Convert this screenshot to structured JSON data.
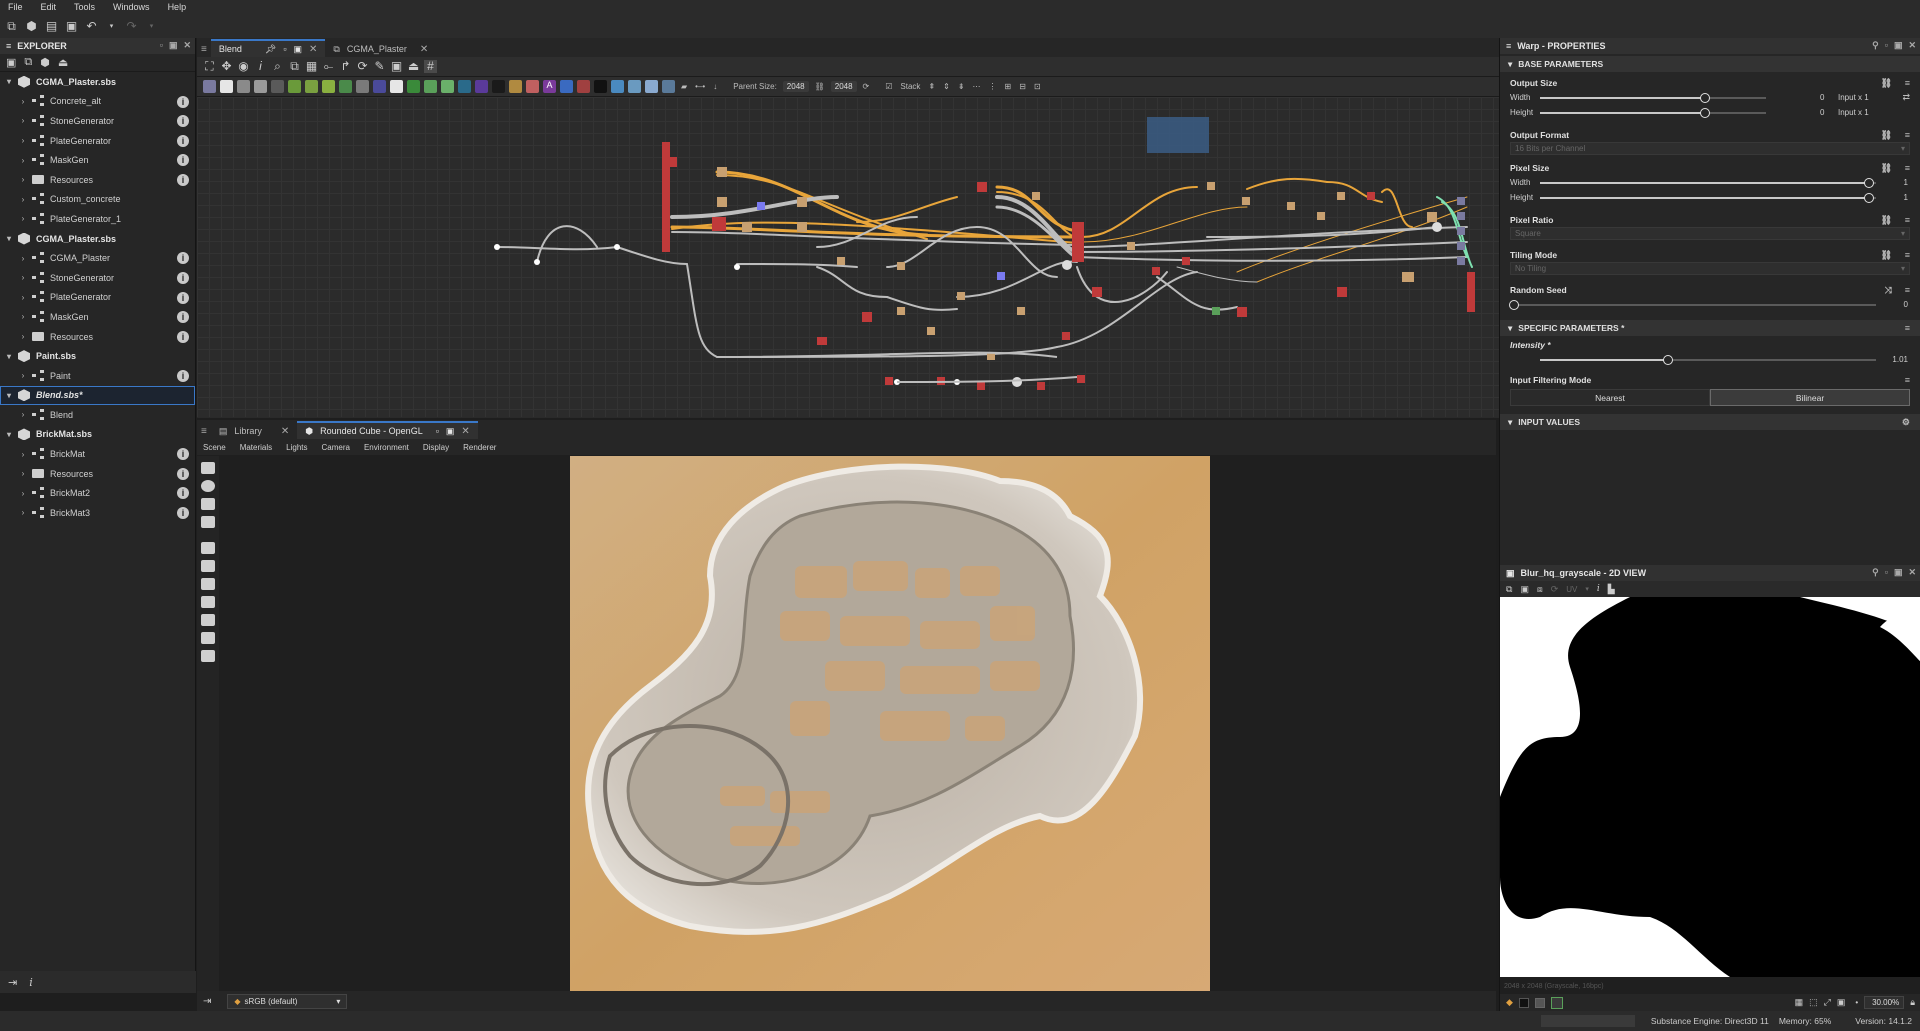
{
  "menu": [
    "File",
    "Edit",
    "Tools",
    "Windows",
    "Help"
  ],
  "explorer": {
    "title": "EXPLORER",
    "tree": [
      {
        "label": "CGMA_Plaster.sbs",
        "kind": "package",
        "depth": 0
      },
      {
        "label": "Concrete_alt",
        "kind": "graph",
        "depth": 1,
        "info": true
      },
      {
        "label": "StoneGenerator",
        "kind": "graph",
        "depth": 1,
        "info": true
      },
      {
        "label": "PlateGenerator",
        "kind": "graph",
        "depth": 1,
        "info": true
      },
      {
        "label": "MaskGen",
        "kind": "graph",
        "depth": 1,
        "info": true
      },
      {
        "label": "Resources",
        "kind": "folder",
        "depth": 1,
        "info": true
      },
      {
        "label": "Custom_concrete",
        "kind": "graph",
        "depth": 1,
        "info": false
      },
      {
        "label": "PlateGenerator_1",
        "kind": "graph",
        "depth": 1,
        "info": false
      },
      {
        "label": "CGMA_Plaster.sbs",
        "kind": "package",
        "depth": 0
      },
      {
        "label": "CGMA_Plaster",
        "kind": "graph",
        "depth": 1,
        "info": true
      },
      {
        "label": "StoneGenerator",
        "kind": "graph",
        "depth": 1,
        "info": true
      },
      {
        "label": "PlateGenerator",
        "kind": "graph",
        "depth": 1,
        "info": true
      },
      {
        "label": "MaskGen",
        "kind": "graph",
        "depth": 1,
        "info": true
      },
      {
        "label": "Resources",
        "kind": "folder",
        "depth": 1,
        "info": true
      },
      {
        "label": "Paint.sbs",
        "kind": "package",
        "depth": 0
      },
      {
        "label": "Paint",
        "kind": "graph",
        "depth": 1,
        "info": true
      },
      {
        "label": "Blend.sbs*",
        "kind": "package",
        "depth": 0,
        "selected": true,
        "italic": true
      },
      {
        "label": "Blend",
        "kind": "graph",
        "depth": 1,
        "info": false
      },
      {
        "label": "BrickMat.sbs",
        "kind": "package",
        "depth": 0
      },
      {
        "label": "BrickMat",
        "kind": "graph",
        "depth": 1,
        "info": true
      },
      {
        "label": "Resources",
        "kind": "folder",
        "depth": 1,
        "info": true
      },
      {
        "label": "BrickMat2",
        "kind": "graph",
        "depth": 1,
        "info": true
      },
      {
        "label": "BrickMat3",
        "kind": "graph",
        "depth": 1,
        "info": true
      }
    ]
  },
  "graph": {
    "tabs": [
      {
        "label": "Blend",
        "active": true
      },
      {
        "label": "CGMA_Plaster",
        "active": false
      }
    ],
    "parent_size_label": "Parent Size:",
    "parent_size": "2048",
    "size2": "2048",
    "stack_label": "Stack"
  },
  "view3d": {
    "tabs": [
      {
        "label": "Library",
        "active": false
      },
      {
        "label": "Rounded Cube - OpenGL",
        "active": true
      }
    ],
    "menu": [
      "Scene",
      "Materials",
      "Lights",
      "Camera",
      "Environment",
      "Display",
      "Renderer"
    ],
    "colorspace": "sRGB (default)"
  },
  "props": {
    "title": "Warp - PROPERTIES",
    "base_section": "BASE PARAMETERS",
    "output_size": {
      "label": "Output Size",
      "width_label": "Width",
      "height_label": "Height",
      "width_val": "0",
      "height_val": "0",
      "width_mode": "Input x 1",
      "height_mode": "Input x 1",
      "width_level": 0.73,
      "height_level": 0.73
    },
    "output_format": {
      "label": "Output Format",
      "value": "16 Bits per Channel"
    },
    "pixel_size": {
      "label": "Pixel Size",
      "width_label": "Width",
      "height_label": "Height",
      "width_val": "1",
      "height_val": "1",
      "width_level": 0.98,
      "height_level": 0.98
    },
    "pixel_ratio": {
      "label": "Pixel Ratio",
      "value": "Square"
    },
    "tiling_mode": {
      "label": "Tiling Mode",
      "value": "No Tiling"
    },
    "random_seed": {
      "label": "Random Seed",
      "value": "0",
      "level": 0.0
    },
    "specific_section": "SPECIFIC PARAMETERS *",
    "intensity": {
      "label": "Intensity *",
      "value": "1.01",
      "level": 0.38
    },
    "filtering": {
      "label": "Input Filtering Mode",
      "options": [
        "Nearest",
        "Bilinear"
      ],
      "selected": "Bilinear"
    },
    "input_section": "INPUT VALUES"
  },
  "view2d": {
    "title": "Blur_hq_grayscale - 2D VIEW",
    "uv_label": "UV",
    "info": "2048 x 2048 (Grayscale, 16bpc)",
    "zoom": "30.00%"
  },
  "status": {
    "engine": "Substance Engine: Direct3D 11",
    "memory": "Memory: 65%",
    "version": "Version: 14.1.2"
  }
}
